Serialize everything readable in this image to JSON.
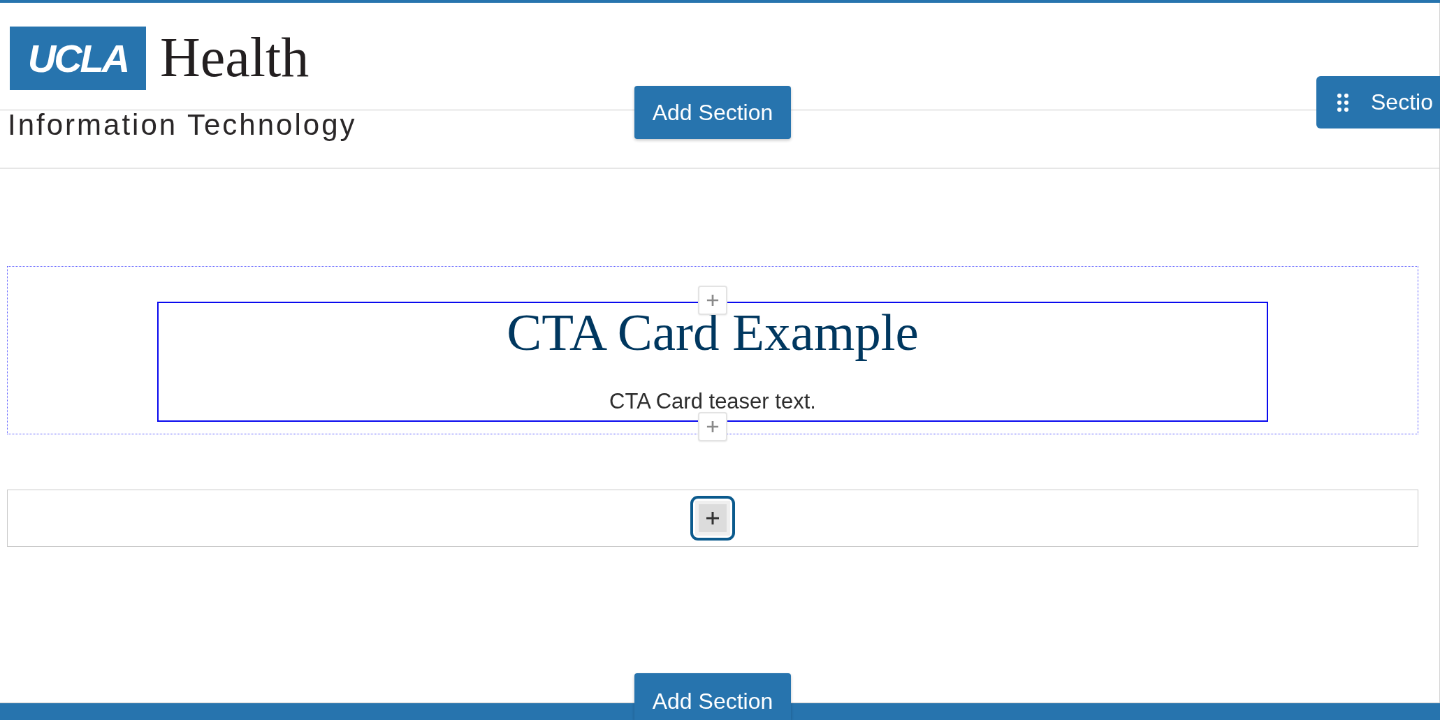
{
  "header": {
    "logo_mark": "UCLA",
    "logo_wordmark": "Health",
    "site_name": "Information Technology"
  },
  "add_section_top": {
    "label": "Add Section"
  },
  "section_handle": {
    "label": "Sectio"
  },
  "sections": [
    {
      "kind": "cta_card",
      "title": "CTA Card Example",
      "teaser": "CTA Card teaser text."
    },
    {
      "kind": "add_block",
      "focused": true
    }
  ],
  "add_section_bottom": {
    "label": "Add Section"
  }
}
